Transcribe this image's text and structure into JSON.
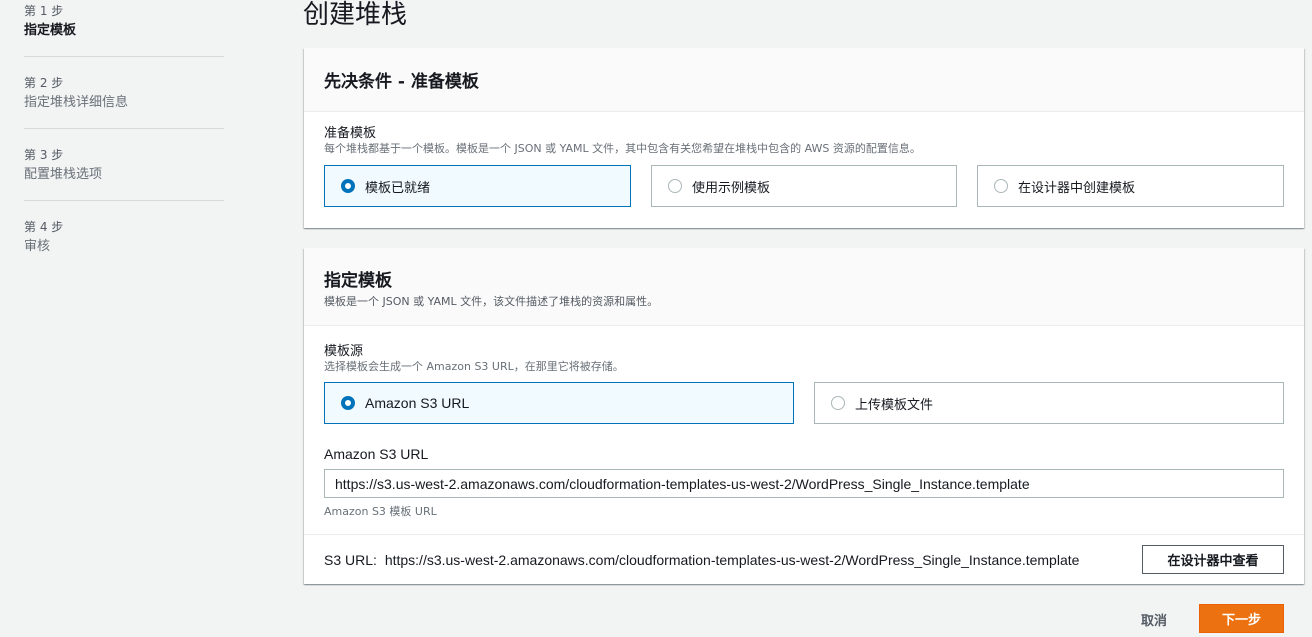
{
  "sidebar": {
    "steps": [
      {
        "number": "第 1 步",
        "name": "指定模板"
      },
      {
        "number": "第 2 步",
        "name": "指定堆栈详细信息"
      },
      {
        "number": "第 3 步",
        "name": "配置堆栈选项"
      },
      {
        "number": "第 4 步",
        "name": "审核"
      }
    ]
  },
  "page_title": "创建堆栈",
  "prerequisite": {
    "title": "先决条件 - 准备模板",
    "field_label": "准备模板",
    "field_desc": "每个堆栈都基于一个模板。模板是一个 JSON 或 YAML 文件，其中包含有关您希望在堆栈中包含的 AWS 资源的配置信息。",
    "options": [
      "模板已就绪",
      "使用示例模板",
      "在设计器中创建模板"
    ],
    "selected": "模板已就绪"
  },
  "specify_template": {
    "title": "指定模板",
    "desc": "模板是一个 JSON 或 YAML 文件，该文件描述了堆栈的资源和属性。",
    "source_label": "模板源",
    "source_desc": "选择模板会生成一个 Amazon S3 URL，在那里它将被存储。",
    "sources": [
      "Amazon S3 URL",
      "上传模板文件"
    ],
    "selected_source": "Amazon S3 URL",
    "url_label": "Amazon S3 URL",
    "url_value": "https://s3.us-west-2.amazonaws.com/cloudformation-templates-us-west-2/WordPress_Single_Instance.template",
    "url_hint": "Amazon S3 模板 URL",
    "s3_url_prefix": "S3 URL:",
    "s3_url_value": "https://s3.us-west-2.amazonaws.com/cloudformation-templates-us-west-2/WordPress_Single_Instance.template",
    "view_in_designer": "在设计器中查看"
  },
  "actions": {
    "cancel": "取消",
    "next": "下一步"
  },
  "colors": {
    "accent_blue": "#0073bb",
    "primary_orange": "#ec7211"
  }
}
